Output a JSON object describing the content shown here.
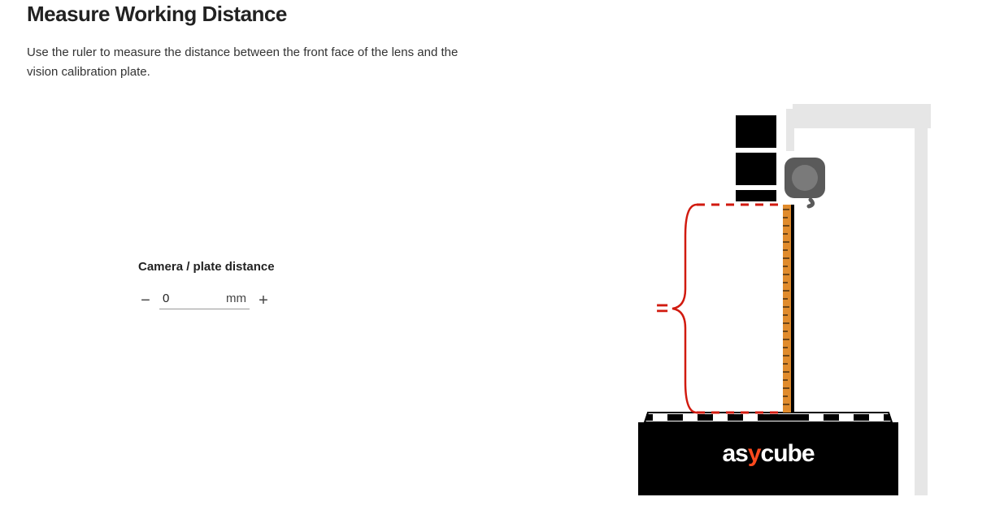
{
  "title": "Measure Working Distance",
  "description": "Use the ruler to measure the distance between the front face of the lens and the vision calibration plate.",
  "control": {
    "label": "Camera / plate distance",
    "value": "0",
    "unit": "mm",
    "minus": "−",
    "plus": "+"
  },
  "diagram": {
    "equals_symbol": "=",
    "device_label": "asycube",
    "accent_color": "#ff4a1e",
    "brace_color": "#d11a0f",
    "ruler_color": "#e08b2c",
    "light_gray": "#e6e6e6",
    "dark_gray": "#5a5a5a"
  }
}
